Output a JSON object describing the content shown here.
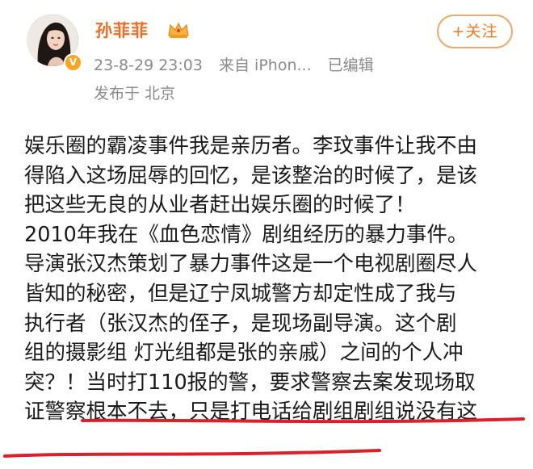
{
  "user": {
    "name": "孙菲菲",
    "verified_icon": "verified-badge-icon",
    "crown_icon": "crown-icon"
  },
  "follow_button": {
    "label": "+关注"
  },
  "meta": {
    "datetime": "23-8-29 23:03",
    "source": "来自 iPhon...",
    "edited": "已编辑",
    "location": "发布于 北京"
  },
  "post": {
    "lines": [
      "娱乐圈的霸凌事件我是亲历者。李玟事件让我不由",
      "得陷入这场屈辱的回忆，是该整治的时候了，是该",
      "把这些无良的从业者赶出娱乐圈的时候了！",
      "2010年我在《血色恋情》剧组经历的暴力事件。",
      "导演张汉杰策划了暴力事件这是一个电视剧圈尽人",
      "皆知的秘密，但是辽宁凤城警方却定性成了我与",
      "执行者（张汉杰的侄子，是现场副导演。这个剧",
      "组的摄影组 灯光组都是张的亲戚）之间的个人冲",
      "突？！当时打110报的警，要求警察去案发现场取",
      "证警察根本不去，只是打电话给剧组剧组说没有这"
    ]
  },
  "colors": {
    "username": "#f26d21",
    "follow_border": "#f0a868",
    "follow_text": "#f07a20",
    "meta_text": "#8a8a8a",
    "underline": "#d8212a"
  }
}
